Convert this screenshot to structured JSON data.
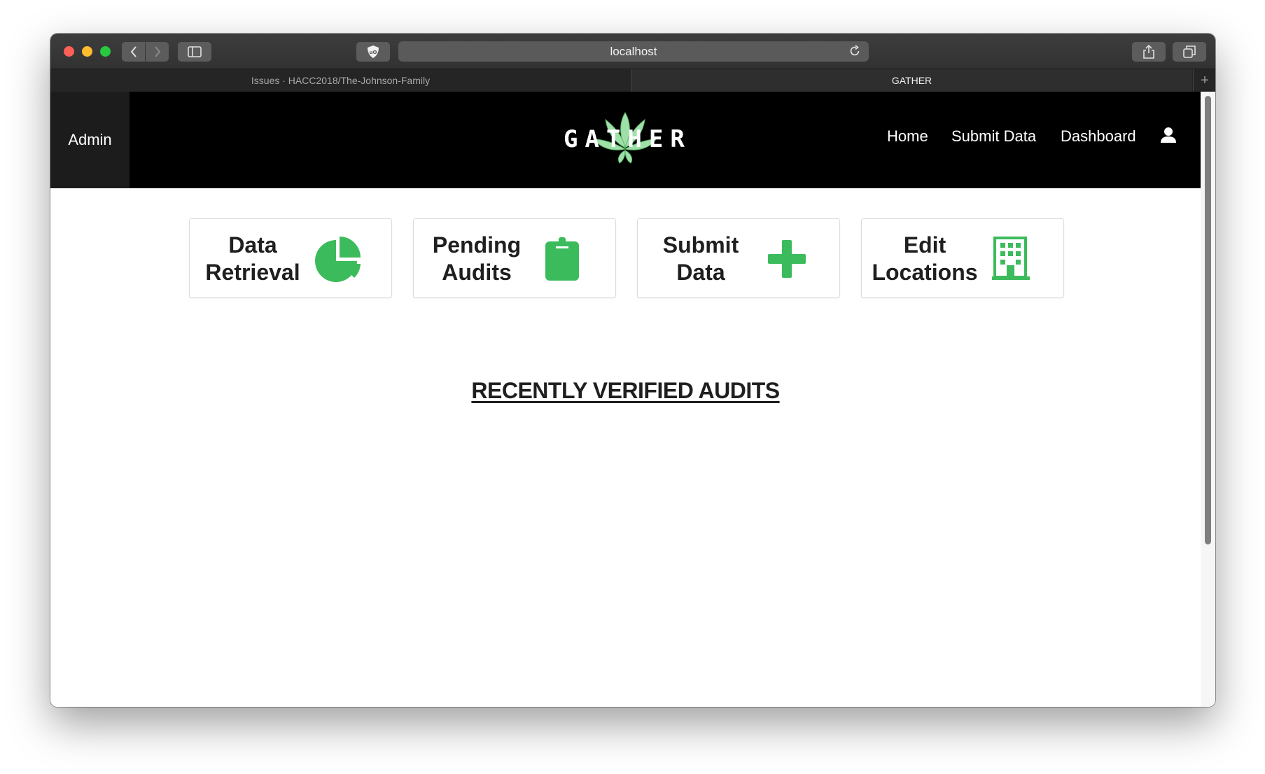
{
  "browser": {
    "url": "localhost",
    "tabs": [
      {
        "label": "Issues · HACC2018/The-Johnson-Family"
      },
      {
        "label": "GATHER"
      }
    ],
    "new_tab_icon": "plus-icon"
  },
  "header": {
    "admin_label": "Admin",
    "logo_text": "GATHER",
    "nav": {
      "home": "Home",
      "submit_data": "Submit Data",
      "dashboard": "Dashboard"
    },
    "user_icon": "user-icon"
  },
  "cards": [
    {
      "line1": "Data",
      "line2": "Retrieval",
      "icon": "pie-chart-icon"
    },
    {
      "line1": "Pending",
      "line2": "Audits",
      "icon": "clipboard-icon"
    },
    {
      "line1": "Submit",
      "line2": "Data",
      "icon": "plus-icon"
    },
    {
      "line1": "Edit",
      "line2": "Locations",
      "icon": "building-icon"
    }
  ],
  "section_heading": "RECENTLY VERIFIED AUDITS",
  "colors": {
    "accent_green": "#3cbb5c",
    "header_bg": "#000000",
    "admin_bg": "#1c1c1c"
  }
}
